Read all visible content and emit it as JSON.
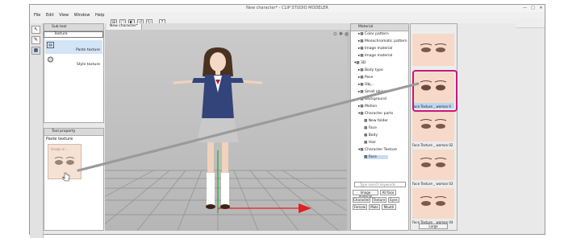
{
  "window": {
    "title": "New character* - CLIP STUDIO MODELER",
    "min": "—",
    "max": "□",
    "close": "✕"
  },
  "menu": [
    "File",
    "Edit",
    "View",
    "Window",
    "Help"
  ],
  "toolbar": {
    "icons": [
      "new",
      "open",
      "save",
      "undo",
      "redo",
      "help"
    ],
    "glyphs": [
      "⊞",
      "▢",
      "◧",
      "↺",
      "↻",
      "?"
    ]
  },
  "sub_tool": {
    "title": "Sub tool",
    "selected_tab": "Texture",
    "items": [
      {
        "label": "Paste texture"
      },
      {
        "label": "Style texture"
      }
    ]
  },
  "tool_property": {
    "title": "Tool property",
    "value": "Paste texture",
    "drag_label": "Image ar..."
  },
  "document": {
    "tab": "New character*"
  },
  "material": {
    "title": "Material",
    "tree": [
      {
        "label": "Color pattern",
        "indent": 1
      },
      {
        "label": "Monochromatic pattern",
        "indent": 1
      },
      {
        "label": "Image material",
        "indent": 1
      },
      {
        "label": "Image material",
        "indent": 1
      },
      {
        "label": "3D",
        "indent": 0
      },
      {
        "label": "Body type",
        "indent": 1
      },
      {
        "label": "Pose",
        "indent": 1
      },
      {
        "label": "Obj...",
        "indent": 1
      },
      {
        "label": "Small object",
        "indent": 1
      },
      {
        "label": "Background",
        "indent": 1
      },
      {
        "label": "Motion",
        "indent": 1
      },
      {
        "label": "Character parts",
        "indent": 1
      },
      {
        "label": "New folder",
        "indent": 2
      },
      {
        "label": "Face",
        "indent": 2
      },
      {
        "label": "Body",
        "indent": 2
      },
      {
        "label": "Hair",
        "indent": 2
      },
      {
        "label": "Character Texture",
        "indent": 1
      },
      {
        "label": "Face",
        "indent": 2,
        "selected": true
      }
    ],
    "search_placeholder": "Type search keywords",
    "tags": [
      "Image material",
      "All face",
      "Character",
      "Texture",
      "Eyes",
      "Female",
      "Male",
      "Mouth"
    ]
  },
  "thumbnails": [
    {
      "caption": ""
    },
    {
      "caption": "Face Texture _ woman 0"
    },
    {
      "caption": "Face Texture _ woman 02"
    },
    {
      "caption": "Face Texture _ woman 03"
    },
    {
      "caption": "Face Texture _ woman 04"
    }
  ],
  "thumb_footer": "Large",
  "colors": {
    "highlight": "#c8177a",
    "axis_x": "#e02020",
    "axis_y": "#20b020",
    "grid": "#8f8f8f"
  }
}
